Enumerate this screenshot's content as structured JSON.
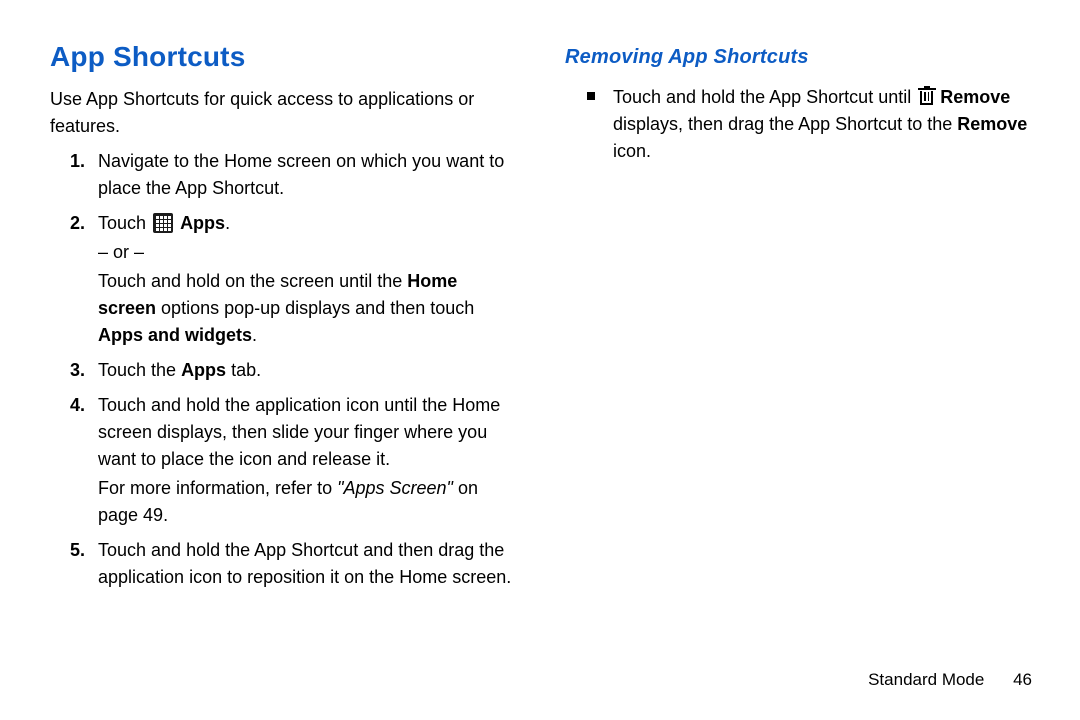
{
  "left": {
    "title": "App Shortcuts",
    "intro": "Use App Shortcuts for quick access to applications or features.",
    "step1": "Navigate to the Home screen on which you want to place the App Shortcut.",
    "step2_pre": "Touch ",
    "step2_label": "Apps",
    "step2_post": ".",
    "or": "– or –",
    "step2b_a": "Touch and hold on the screen until the ",
    "step2b_bold1": "Home screen",
    "step2b_b": " options pop-up displays and then touch ",
    "step2b_bold2": "Apps and widgets",
    "step2b_c": ".",
    "step3_a": "Touch the ",
    "step3_bold": "Apps",
    "step3_b": " tab.",
    "step4": "Touch and hold the application icon until the Home screen displays, then slide your finger where you want to place the icon and release it.",
    "step4ref_a": "For more information, refer to ",
    "step4ref_italic": "\"Apps Screen\"",
    "step4ref_b": " on page 49.",
    "step5": "Touch and hold the App Shortcut and then drag the application icon to reposition it on the Home screen."
  },
  "right": {
    "title": "Removing App Shortcuts",
    "b1_a": "Touch and hold the App Shortcut until ",
    "b1_bold1": "Remove",
    "b1_b": " displays, then drag the App Shortcut to the ",
    "b1_bold2": "Remove",
    "b1_c": " icon."
  },
  "footer": {
    "section": "Standard Mode",
    "page": "46"
  }
}
